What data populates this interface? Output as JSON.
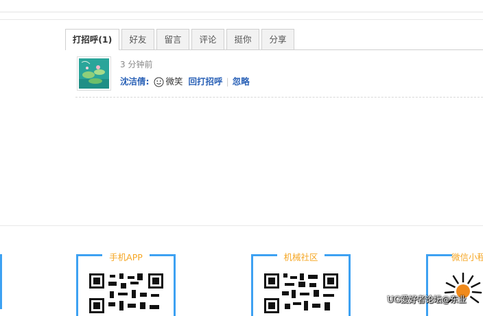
{
  "tabs": [
    {
      "label": "打招呼(1)",
      "active": true
    },
    {
      "label": "好友",
      "active": false
    },
    {
      "label": "留言",
      "active": false
    },
    {
      "label": "评论",
      "active": false
    },
    {
      "label": "挺你",
      "active": false
    },
    {
      "label": "分享",
      "active": false
    }
  ],
  "feed": {
    "time": "3 分钟前",
    "user": "沈洁倩",
    "colon": ":",
    "action": "微笑",
    "reply_link": "回打招呼",
    "separator": "|",
    "ignore_link": "忽略"
  },
  "footer": {
    "cards": [
      {
        "label": "手机APP"
      },
      {
        "label": "机械社区"
      },
      {
        "label": "微信小程"
      }
    ]
  },
  "watermark": "UG爱好者论坛@东业",
  "colors": {
    "accent_blue": "#3da1f2",
    "label_orange": "#f5a623",
    "link_blue": "#2b62b7"
  }
}
